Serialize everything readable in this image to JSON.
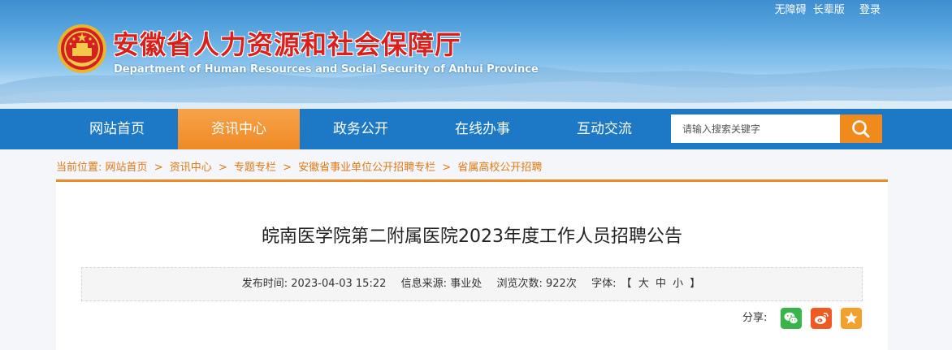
{
  "header": {
    "title": "安徽省人力资源和社会保障厅",
    "subtitle": "Department of Human Resources and Social Security of Anhui Province",
    "top_links": {
      "accessibility": "无障碍",
      "elderly": "长辈版",
      "login": "登录"
    }
  },
  "nav": {
    "items": [
      {
        "label": "网站首页"
      },
      {
        "label": "资讯中心"
      },
      {
        "label": "政务公开"
      },
      {
        "label": "在线办事"
      },
      {
        "label": "互动交流"
      }
    ],
    "active_index": 1
  },
  "search": {
    "placeholder": "请输入搜索关键字",
    "icon": "search-icon"
  },
  "breadcrumb": {
    "prefix": "当前位置:",
    "items": [
      "网站首页",
      "资讯中心",
      "专题专栏",
      "安徽省事业单位公开招聘专栏",
      "省属高校公开招聘"
    ],
    "separator": ">"
  },
  "article": {
    "title": "皖南医学院第二附属医院2023年度工作人员招聘公告",
    "meta": {
      "publish_label": "发布时间:",
      "publish_time": "2023-04-03 15:22",
      "source_label": "信息来源:",
      "source": "事业处",
      "views_label": "浏览次数:",
      "views": "922次",
      "font_label": "字体:",
      "font_open": "【",
      "font_large": "大",
      "font_medium": "中",
      "font_small": "小",
      "font_close": "】"
    },
    "share": {
      "label": "分享:",
      "buttons": [
        {
          "name": "wechat-icon",
          "color": "#38b549"
        },
        {
          "name": "weibo-icon",
          "color": "#f05a22"
        },
        {
          "name": "favorite-star-icon",
          "color": "#f2a12c"
        }
      ]
    }
  },
  "colors": {
    "nav_bg": "#1d78c6",
    "nav_active": "#ef8a25",
    "title_red": "#d9201c",
    "breadcrumb": "#e07a17",
    "search_button": "#f08a1c"
  }
}
